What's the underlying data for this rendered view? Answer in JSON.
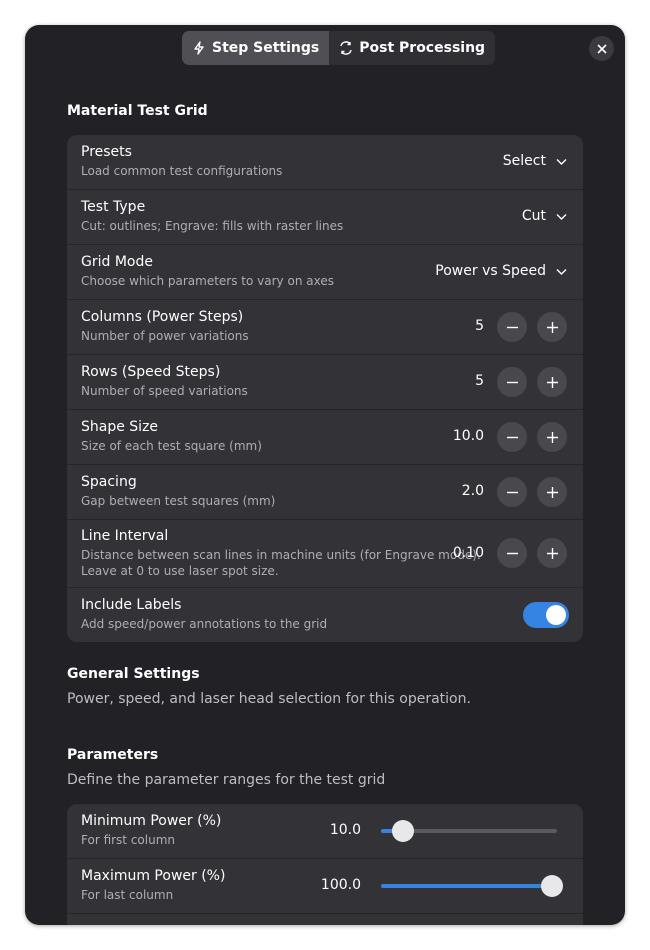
{
  "tabs": [
    {
      "label": "Step Settings",
      "icon": "lightning-icon",
      "active": true
    },
    {
      "label": "Post Processing",
      "icon": "process-icon",
      "active": false
    }
  ],
  "material_test_grid": {
    "title": "Material Test Grid",
    "presets": {
      "title": "Presets",
      "subtitle": "Load common test configurations",
      "value": "Select"
    },
    "test_type": {
      "title": "Test Type",
      "subtitle": "Cut: outlines; Engrave: fills with raster lines",
      "value": "Cut"
    },
    "grid_mode": {
      "title": "Grid Mode",
      "subtitle": "Choose which parameters to vary on axes",
      "value": "Power vs Speed"
    },
    "columns": {
      "title": "Columns (Power Steps)",
      "subtitle": "Number of power variations",
      "value": "5"
    },
    "rows": {
      "title": "Rows (Speed Steps)",
      "subtitle": "Number of speed variations",
      "value": "5"
    },
    "shape_size": {
      "title": "Shape Size",
      "subtitle": "Size of each test square (mm)",
      "value": "10.0"
    },
    "spacing": {
      "title": "Spacing",
      "subtitle": "Gap between test squares (mm)",
      "value": "2.0"
    },
    "line_interval": {
      "title": "Line Interval",
      "subtitle_line1": "Distance between scan lines in machine units (for Engrave mode).",
      "subtitle_line2": "Leave at 0 to use laser spot size.",
      "value": "0.10"
    },
    "include_labels": {
      "title": "Include Labels",
      "subtitle": "Add speed/power annotations to the grid",
      "enabled": true
    }
  },
  "general_settings": {
    "title": "General Settings",
    "description": "Power, speed, and laser head selection for this operation."
  },
  "parameters": {
    "title": "Parameters",
    "description": "Define the parameter ranges for the test grid",
    "min_power": {
      "title": "Minimum Power (%)",
      "subtitle": "For first column",
      "value": "10.0",
      "level_fraction": 0.1
    },
    "max_power": {
      "title": "Maximum Power (%)",
      "subtitle": "For last column",
      "value": "100.0",
      "level_fraction": 1.0
    }
  },
  "colors": {
    "accent": "#3584e4",
    "window_bg": "#222226",
    "card_bg": "#323237"
  }
}
